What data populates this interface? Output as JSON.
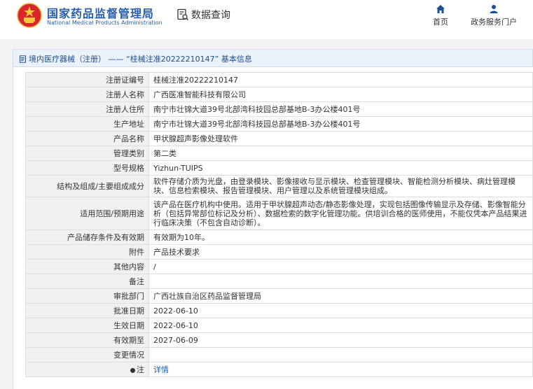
{
  "header": {
    "brand_cn": "国家药品监督管理局",
    "brand_en": "National Medical Products Administration",
    "query_label": "数据查询",
    "nav": [
      {
        "label": "首页",
        "icon": "home-icon"
      },
      {
        "label": "政务服务门户",
        "icon": "user-icon"
      }
    ]
  },
  "breadcrumb": {
    "text": "境内医疗器械（注册） —— “桂械注准20222210147” 基本信息"
  },
  "colors": {
    "brand_blue": "#2a5ea8",
    "link_blue": "#1a5fb4",
    "label_bg": "#f1f1f1",
    "breadcrumb_bg": "#eaf1f8"
  },
  "rows": [
    {
      "label": "注册证编号",
      "value": "桂械注准20222210147"
    },
    {
      "label": "注册人名称",
      "value": "广西医准智能科技有限公司"
    },
    {
      "label": "注册人住所",
      "value": "南宁市壮锦大道39号北部湾科技园总部基地B-3办公楼401号"
    },
    {
      "label": "生产地址",
      "value": "南宁市壮锦大道39号北部湾科技园总部基地B-3办公楼401号"
    },
    {
      "label": "产品名称",
      "value": "甲状腺超声影像处理软件"
    },
    {
      "label": "管理类别",
      "value": "第二类"
    },
    {
      "label": "型号规格",
      "value": "Yizhun-TUIPS"
    },
    {
      "label": "结构及组成/主要组成成分",
      "value": "软件存储介质为光盘，由登录模块、影像接收与显示模块、检查管理模块、智能检测分析模块、病灶管理模块、信息检索模块、报告管理模块、用户管理以及系统管理模块组成。"
    },
    {
      "label": "适用范围/预期用途",
      "value": "该产品在医疗机构中使用。适用于甲状腺超声动态/静态影像处理，实现包括图像传输显示及存储、影像智能分析（包括异常部位标记及分析）、数据检索的数字化管理功能。供培训合格的医师使用，不能仅凭本产品结果进行临床决策（不包含自动诊断）。"
    },
    {
      "label": "产品储存条件及有效期",
      "value": "有效期为10年。"
    },
    {
      "label": "附件",
      "value": "产品技术要求"
    },
    {
      "label": "其他内容",
      "value": "/"
    },
    {
      "label": "备注",
      "value": ""
    },
    {
      "label": "审批部门",
      "value": "广西壮族自治区药品监督管理局"
    },
    {
      "label": "批准日期",
      "value": "2022-06-10"
    },
    {
      "label": "生效日期",
      "value": "2022-06-10"
    },
    {
      "label": "有效期至",
      "value": "2027-06-09"
    },
    {
      "label": "变更情况",
      "value": ""
    }
  ],
  "note_row": {
    "label": "注",
    "link": "详情"
  }
}
